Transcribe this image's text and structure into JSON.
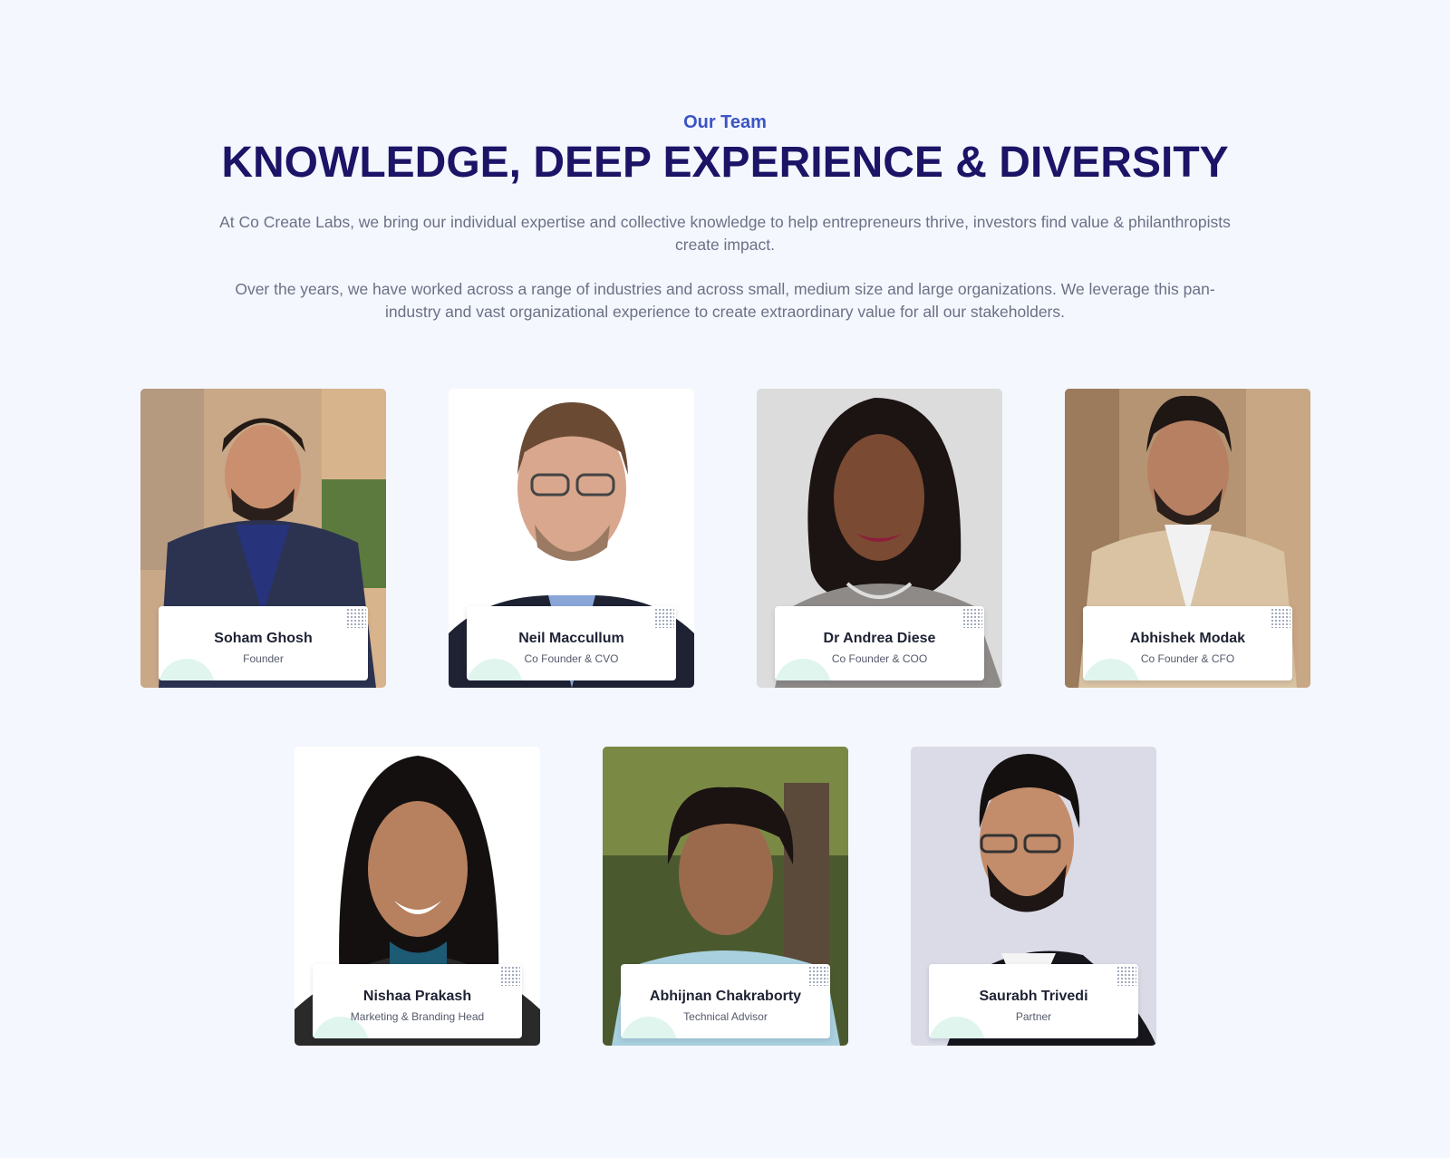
{
  "header": {
    "eyebrow": "Our Team",
    "title": "KNOWLEDGE, DEEP EXPERIENCE & DIVERSITY",
    "paragraph_1": "At Co Create Labs, we bring our individual expertise and collective knowledge to help entrepreneurs thrive, investors find value & philanthropists create impact.",
    "paragraph_2": "Over the years,  we have worked across a range of industries and across small, medium size and large organizations. We leverage this pan-industry and vast organizational experience to create extraordinary value for all our stakeholders."
  },
  "team": [
    {
      "name": "Soham Ghosh",
      "role": "Founder"
    },
    {
      "name": "Neil Maccullum",
      "role": "Co Founder & CVO"
    },
    {
      "name": "Dr Andrea Diese",
      "role": "Co Founder & COO"
    },
    {
      "name": "Abhishek Modak",
      "role": "Co Founder & CFO"
    },
    {
      "name": "Nishaa Prakash",
      "role": "Marketing & Branding Head"
    },
    {
      "name": "Abhijnan Chakraborty",
      "role": "Technical Advisor"
    },
    {
      "name": "Saurabh Trivedi",
      "role": "Partner"
    }
  ],
  "colors": {
    "background": "#f4f7fe",
    "eyebrow": "#3b55c4",
    "headline": "#1c1466",
    "body_text": "#6b7185"
  }
}
